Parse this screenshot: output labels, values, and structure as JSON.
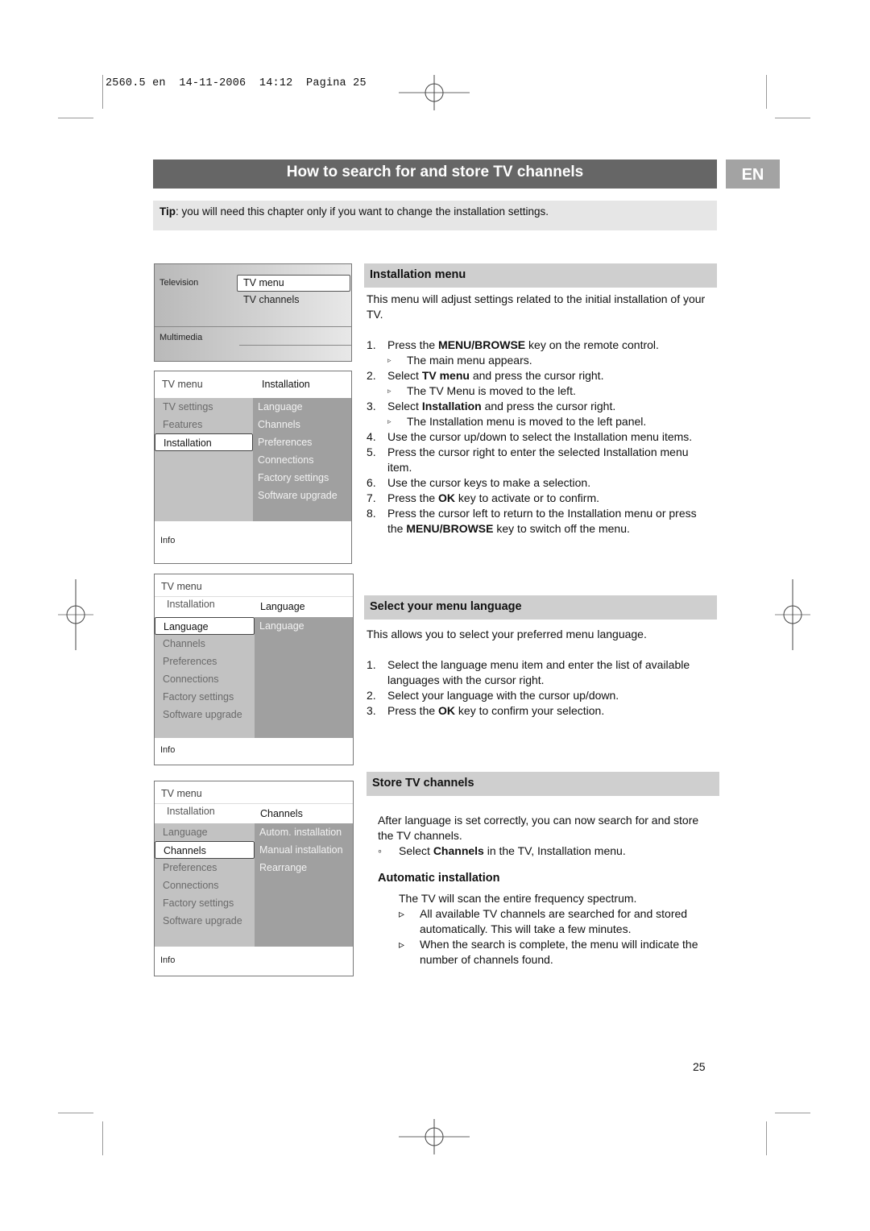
{
  "slug": {
    "text": "2560.5 en  14-11-2006  14:12  Pagina 25"
  },
  "header": {
    "title": "How to search for and store TV channels",
    "lang_badge": "EN"
  },
  "tip": {
    "label": "Tip",
    "text": ": you will need this chapter only if you want to change the installation settings."
  },
  "screens": {
    "main": {
      "left_top": "Television",
      "left_bottom": "Multimedia",
      "selected": "TV menu",
      "second": "TV channels"
    },
    "installation": {
      "head_left": "TV menu",
      "head_right": "Installation",
      "left_items": [
        "TV settings",
        "Features",
        "Installation",
        "",
        "",
        "",
        ""
      ],
      "selected_index": 2,
      "right_items": [
        "Language",
        "Channels",
        "Preferences",
        "Connections",
        "Factory settings",
        "Software upgrade",
        ""
      ],
      "info": "Info"
    },
    "language": {
      "head_title": "TV menu",
      "head_left": "Installation",
      "head_right": "Language",
      "left_items": [
        "Language",
        "Channels",
        "Preferences",
        "Connections",
        "Factory settings",
        "Software upgrade",
        ""
      ],
      "selected_index": 0,
      "right_items": [
        "Language",
        "",
        "",
        "",
        "",
        "",
        ""
      ],
      "info": "Info"
    },
    "channels": {
      "head_title": "TV menu",
      "head_left": "Installation",
      "head_right": "Channels",
      "left_items": [
        "Language",
        "Channels",
        "Preferences",
        "Connections",
        "Factory settings",
        "Software upgrade",
        ""
      ],
      "selected_index": 1,
      "right_items": [
        "Autom. installation",
        "Manual installation",
        "Rearrange",
        "",
        "",
        "",
        ""
      ],
      "info": "Info"
    }
  },
  "installation_menu": {
    "heading": "Installation menu",
    "intro": "This menu will adjust settings related to the initial installation of your TV.",
    "steps": [
      {
        "num": "1.",
        "pre": "Press the ",
        "bold": "MENU/BROWSE",
        "post": " key on the remote control."
      },
      {
        "num": "▹",
        "sub": true,
        "pre": "The main menu appears.",
        "bold": "",
        "post": ""
      },
      {
        "num": "2.",
        "pre": "Select ",
        "bold": "TV menu",
        "post": " and press the cursor right."
      },
      {
        "num": "▹",
        "sub": true,
        "pre": "The TV Menu is moved to the left.",
        "bold": "",
        "post": ""
      },
      {
        "num": "3.",
        "pre": "Select ",
        "bold": "Installation",
        "post": " and press the cursor right."
      },
      {
        "num": "▹",
        "sub": true,
        "pre": "The Installation menu is moved to the left panel.",
        "bold": "",
        "post": ""
      },
      {
        "num": "4.",
        "pre": "Use the cursor up/down to select the Installation menu items.",
        "bold": "",
        "post": ""
      },
      {
        "num": "5.",
        "pre": "Press the cursor right to enter the selected Installation menu item.",
        "bold": "",
        "post": ""
      },
      {
        "num": "6.",
        "pre": "Use the cursor keys to make a selection.",
        "bold": "",
        "post": ""
      },
      {
        "num": "7.",
        "pre": "Press the ",
        "bold": "OK",
        "post": " key to activate or to confirm."
      },
      {
        "num": "8.",
        "pre": "Press the cursor left to return to the Installation menu or press the ",
        "bold": "MENU/BROWSE",
        "post": " key to switch off the menu."
      }
    ]
  },
  "menu_language": {
    "heading": "Select your menu language",
    "intro": "This allows you to select your preferred menu language.",
    "steps": [
      {
        "num": "1.",
        "pre": "Select the language menu item and enter the list of available languages with the cursor right.",
        "bold": "",
        "post": ""
      },
      {
        "num": "2.",
        "pre": "Select your language with the cursor up/down.",
        "bold": "",
        "post": ""
      },
      {
        "num": "3.",
        "pre": "Press the ",
        "bold": "OK",
        "post": " key to confirm your selection."
      }
    ]
  },
  "store_channels": {
    "heading": "Store TV channels",
    "intro": "After language is set correctly, you can now search for and store the TV channels.",
    "bullet": {
      "num": "◦",
      "pre": "Select ",
      "bold": "Channels",
      "post": " in the TV, Installation menu."
    },
    "auto_heading": "Automatic installation",
    "auto_intro": "The TV will scan the entire frequency spectrum.",
    "auto_points": [
      {
        "num": "▹",
        "pre": "All available TV channels are searched for and stored automatically. This will take a few minutes.",
        "bold": "",
        "post": ""
      },
      {
        "num": "▹",
        "pre": "When the search is complete, the menu will indicate the number of channels found.",
        "bold": "",
        "post": ""
      }
    ]
  },
  "footer": {
    "page_number": "25"
  }
}
